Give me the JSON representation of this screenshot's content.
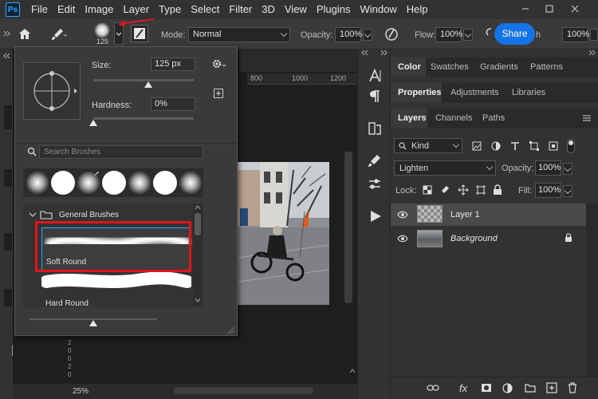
{
  "app": {
    "logo_text": "Ps"
  },
  "menu": [
    "File",
    "Edit",
    "Image",
    "Layer",
    "Type",
    "Select",
    "Filter",
    "3D",
    "View",
    "Plugins",
    "Window",
    "Help"
  ],
  "options_bar": {
    "brush_size": "125",
    "mode_label": "Mode:",
    "mode_value": "Normal",
    "opacity_label": "Opacity:",
    "opacity_value": "100%",
    "flow_label": "Flow:",
    "flow_value": "100%",
    "smoothing_partial": "h",
    "smoothing_value": "100%",
    "share_label": "Share"
  },
  "brush_panel": {
    "size_label": "Size:",
    "size_value": "125 px",
    "size_level": 0.55,
    "hardness_label": "Hardness:",
    "hardness_value": "0%",
    "hardness_level": 0.0,
    "search_placeholder": "Search Brushes",
    "group_name": "General Brushes",
    "brushes": [
      {
        "name": "Soft Round",
        "selected": true
      },
      {
        "name": "Hard Round",
        "selected": false
      }
    ]
  },
  "canvas": {
    "ruler_ticks": [
      "800",
      "1000",
      "1200"
    ],
    "zoom": "25%",
    "vertical_ruler": [
      "2",
      "0",
      "0",
      "2",
      "0"
    ]
  },
  "right_panel": {
    "tabs_row1": [
      "Color",
      "Swatches",
      "Gradients",
      "Patterns"
    ],
    "tabs_row2": [
      "Properties",
      "Adjustments",
      "Libraries"
    ],
    "tabs_row3": [
      "Layers",
      "Channels",
      "Paths"
    ],
    "filter_kind": "Kind",
    "blend_mode": "Lighten",
    "opacity_label": "Opacity:",
    "opacity_value": "100%",
    "lock_label": "Lock:",
    "fill_label": "Fill:",
    "fill_value": "100%",
    "layers": [
      {
        "name": "Layer 1",
        "selected": true
      },
      {
        "name": "Background",
        "selected": false
      }
    ]
  },
  "colors": {
    "accent": "#1473e6",
    "highlight_box": "#e0141e",
    "selection": "#31a8ff"
  }
}
